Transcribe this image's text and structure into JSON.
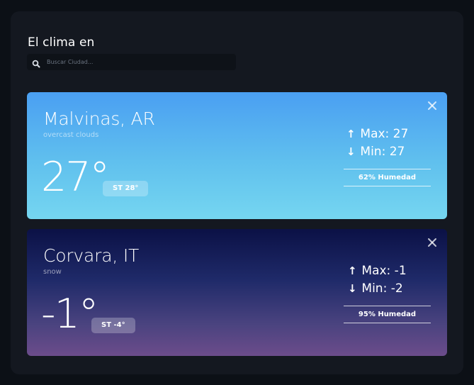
{
  "header": {
    "title": "El clima en"
  },
  "search": {
    "placeholder": "Buscar Ciudad..."
  },
  "cards": [
    {
      "city": "Malvinas, AR",
      "description": "overcast clouds",
      "temperature": "27°",
      "feels_like": "ST 28°",
      "max": "Max: 27",
      "min": "Min: 27",
      "humidity": "62% Humedad",
      "theme": "sunny"
    },
    {
      "city": "Corvara, IT",
      "description": "snow",
      "temperature": "-1°",
      "feels_like": "ST -4°",
      "max": "Max: -1",
      "min": "Min: -2",
      "humidity": "95% Humedad",
      "theme": "night"
    }
  ],
  "icons": {
    "search": "search-icon",
    "close": "close-icon",
    "up": "arrow-up-icon",
    "down": "arrow-down-icon"
  },
  "colors": {
    "page_bg": "#0c1016",
    "panel_bg": "#141820",
    "sunny_top": "#4a9ff2",
    "sunny_bottom": "#75d6f0",
    "night_top": "#0b1146",
    "night_bottom": "#6c4c8b"
  }
}
